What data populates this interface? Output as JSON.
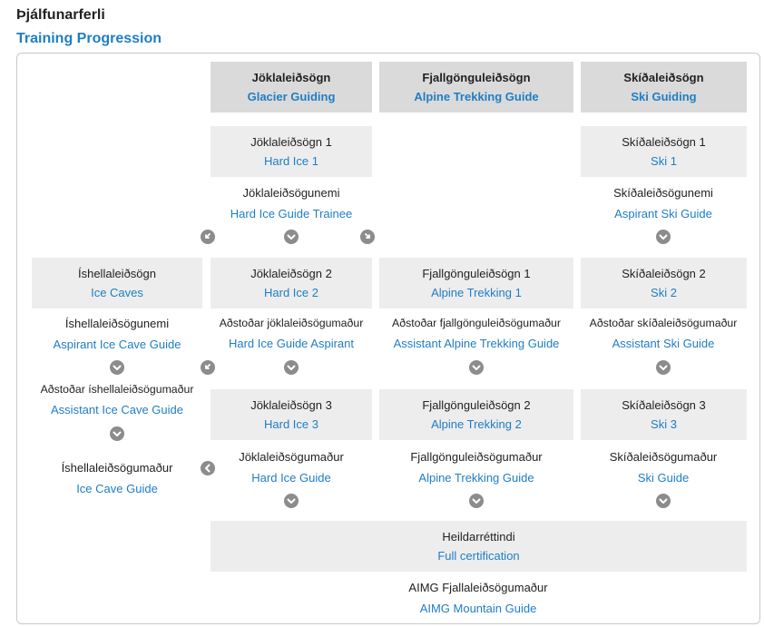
{
  "header": {
    "title_is": "Þjálfunarferli",
    "title_en": "Training Progression"
  },
  "tracks": {
    "glacier": {
      "is": "Jöklaleiðsögn",
      "en": "Glacier Guiding"
    },
    "alpine": {
      "is": "Fjallgönguleiðsögn",
      "en": "Alpine Trekking Guide"
    },
    "ski": {
      "is": "Skíðaleiðsögn",
      "en": "Ski Guiding"
    }
  },
  "courses": {
    "hard_ice_1": {
      "is": "Jöklaleiðsögn 1",
      "en": "Hard Ice 1"
    },
    "ski_1": {
      "is": "Skíðaleiðsögn 1",
      "en": "Ski 1"
    },
    "ice_caves": {
      "is": "Íshellaleiðsögn",
      "en": "Ice Caves"
    },
    "hard_ice_2": {
      "is": "Jöklaleiðsögn 2",
      "en": "Hard Ice 2"
    },
    "alpine_1": {
      "is": "Fjallgönguleiðsögn 1",
      "en": "Alpine Trekking 1"
    },
    "ski_2": {
      "is": "Skíðaleiðsögn 2",
      "en": "Ski 2"
    },
    "hard_ice_3": {
      "is": "Jöklaleiðsögn 3",
      "en": "Hard Ice 3"
    },
    "alpine_2": {
      "is": "Fjallgönguleiðsögn 2",
      "en": "Alpine Trekking 2"
    },
    "ski_3": {
      "is": "Skíðaleiðsögn 3",
      "en": "Ski 3"
    },
    "full_cert": {
      "is": "Heildarréttindi",
      "en": "Full certification"
    }
  },
  "levels": {
    "hard_ice_trainee": {
      "is": "Jöklaleiðsögunemi",
      "en": "Hard Ice Guide Trainee"
    },
    "aspirant_ski": {
      "is": "Skíðaleiðsögunemi",
      "en": "Aspirant Ski Guide"
    },
    "aspirant_ice_cave": {
      "is": "Íshellaleiðsögunemi",
      "en": "Aspirant Ice Cave Guide"
    },
    "hard_ice_aspirant": {
      "is": "Aðstoðar jöklaleiðsögumaður",
      "en": "Hard Ice Guide Aspirant"
    },
    "assistant_alpine": {
      "is": "Aðstoðar fjallgönguleiðsögumaður",
      "en": "Assistant Alpine Trekking Guide"
    },
    "assistant_ski": {
      "is": "Aðstoðar skíðaleiðsögumaður",
      "en": "Assistant Ski Guide"
    },
    "assistant_ice_cave": {
      "is": "Aðstoðar íshellaleiðsögumaður",
      "en": "Assistant Ice Cave Guide"
    },
    "hard_ice_guide": {
      "is": "Jöklaleiðsögumaður",
      "en": "Hard Ice Guide"
    },
    "alpine_guide": {
      "is": "Fjallgönguleiðsögumaður",
      "en": "Alpine Trekking Guide"
    },
    "ski_guide": {
      "is": "Skíðaleiðsögumaður",
      "en": "Ski Guide"
    },
    "ice_cave_guide": {
      "is": "Íshellaleiðsögumaður",
      "en": "Ice Cave Guide"
    },
    "aimg": {
      "is": "AIMG Fjallaleiðsögumaður",
      "en": "AIMG Mountain Guide"
    }
  },
  "icons": {
    "arrow_down": "chevron-down-icon",
    "arrow_left": "chevron-left-icon",
    "arrow_down_left": "arrow-down-left-icon",
    "arrow_down_right": "arrow-down-right-icon"
  },
  "colors": {
    "link_blue": "#1f7ec4",
    "header_box": "#dadada",
    "course_box": "#ededed",
    "arrow_circle": "#8c8c8c"
  }
}
